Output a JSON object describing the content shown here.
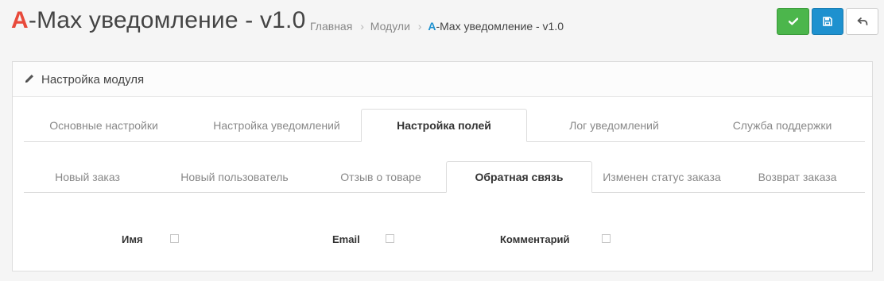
{
  "header": {
    "title_brand": "A",
    "title_rest": "-Max уведомление - v1.0",
    "breadcrumb": {
      "home": "Главная",
      "modules": "Модули",
      "current_brand": "A",
      "current_rest": "-Max уведомление - v1.0",
      "separator": "›"
    },
    "buttons": {
      "save_icon": "check-icon",
      "apply_icon": "floppy-disk-icon",
      "back_icon": "reply-arrow-icon"
    }
  },
  "panel": {
    "title": "Настройка модуля",
    "title_icon": "pencil-icon",
    "main_tabs": [
      {
        "label": "Основные настройки",
        "active": false
      },
      {
        "label": "Настройка уведомлений",
        "active": false
      },
      {
        "label": "Настройка полей",
        "active": true
      },
      {
        "label": "Лог уведомлений",
        "active": false
      },
      {
        "label": "Служба поддержки",
        "active": false
      }
    ],
    "sub_tabs": [
      {
        "label": "Новый заказ",
        "active": false
      },
      {
        "label": "Новый пользователь",
        "active": false
      },
      {
        "label": "Отзыв о товаре",
        "active": false
      },
      {
        "label": "Обратная связь",
        "active": true
      },
      {
        "label": "Изменен статус заказа",
        "active": false
      },
      {
        "label": "Возврат заказа",
        "active": false
      }
    ],
    "fields": [
      {
        "label": "Имя",
        "checked": false
      },
      {
        "label": "Email",
        "checked": false
      },
      {
        "label": "Комментарий",
        "checked": false
      }
    ]
  },
  "colors": {
    "brand_red": "#e84a3b",
    "brand_blue": "#1e91cf",
    "save_green": "#4cb64c",
    "apply_blue": "#1e91cf"
  }
}
